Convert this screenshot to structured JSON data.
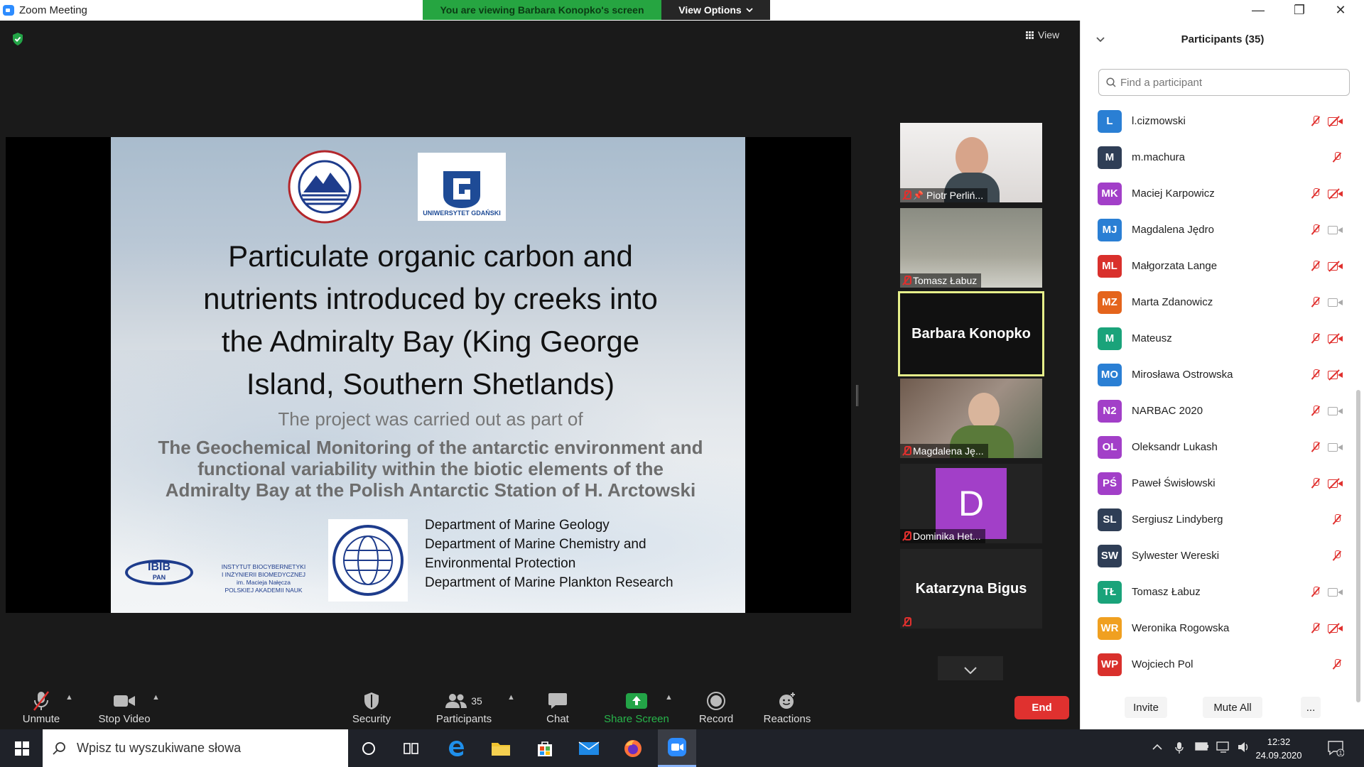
{
  "window": {
    "title": "Zoom Meeting",
    "banner": "You are viewing Barbara Konopko's screen",
    "view_options": "View Options",
    "minimize": "—",
    "restore": "❐",
    "close": "✕"
  },
  "meeting": {
    "view_label": "View",
    "slide": {
      "title_lines": [
        "Particulate organic carbon and",
        "nutrients introduced by creeks  into",
        "the Admiralty Bay (King George",
        "Island, Southern Shetlands)"
      ],
      "subtitle": "The project was carried out as part of",
      "project_lines": [
        "The Geochemical Monitoring of the antarctic environment and",
        "functional variability within the biotic elements of the",
        "Admiralty Bay at the Polish Antarctic Station of H. Arctowski"
      ],
      "departments": [
        "Department of Marine Geology",
        "Department of Marine Chemistry and",
        "Environmental Protection",
        "Department of Marine Plankton Research"
      ],
      "logo_ug_text": "UNIWERSYTET GDAŃSKI",
      "logo_ibib_text": "IBIB",
      "logo_ibib_pan": "PAN",
      "ibib_institute_lines": [
        "INSTYTUT BIOCYBERNETYKI",
        "I INŻYNIERII BIOMEDYCZNEJ",
        "im. Macieja Nałęcza",
        "POLSKIEJ AKADEMII NAUK"
      ]
    },
    "thumbnails": [
      {
        "name": "Piotr Perliń..."
      },
      {
        "name": "Tomasz Łabuz"
      },
      {
        "name": "Barbara Konopko"
      },
      {
        "name": "Magdalena Ję..."
      },
      {
        "name": "Dominika Het...",
        "initial": "D"
      },
      {
        "name": "Katarzyna Bigus"
      }
    ]
  },
  "toolbar": {
    "unmute": "Unmute",
    "stop_video": "Stop Video",
    "security": "Security",
    "participants": "Participants",
    "participants_count": "35",
    "chat": "Chat",
    "share_screen": "Share Screen",
    "record": "Record",
    "reactions": "Reactions",
    "end": "End"
  },
  "panel": {
    "title": "Participants (35)",
    "search_placeholder": "Find a participant",
    "participants": [
      {
        "initials": "L",
        "name": "l.cizmowski",
        "color": "#2a7fd4",
        "cam": "off"
      },
      {
        "initials": "M",
        "name": "m.machura",
        "color": "#2f3e56",
        "cam": "none"
      },
      {
        "initials": "MK",
        "name": "Maciej Karpowicz",
        "color": "#a23fc8",
        "cam": "off"
      },
      {
        "initials": "MJ",
        "name": "Magdalena Jędro",
        "color": "#2a7fd4",
        "cam": "on"
      },
      {
        "initials": "ML",
        "name": "Małgorzata Lange",
        "color": "#d9302c",
        "cam": "off"
      },
      {
        "initials": "MZ",
        "name": "Marta Zdanowicz",
        "color": "#e4641c",
        "cam": "on"
      },
      {
        "initials": "M",
        "name": "Mateusz",
        "color": "#1aa37a",
        "cam": "off"
      },
      {
        "initials": "MO",
        "name": "Mirosława Ostrowska",
        "color": "#2a7fd4",
        "cam": "off"
      },
      {
        "initials": "N2",
        "name": "NARBAC 2020",
        "color": "#a23fc8",
        "cam": "on"
      },
      {
        "initials": "OL",
        "name": "Oleksandr Lukash",
        "color": "#a23fc8",
        "cam": "on"
      },
      {
        "initials": "PŚ",
        "name": "Paweł Świsłowski",
        "color": "#a23fc8",
        "cam": "off"
      },
      {
        "initials": "SL",
        "name": "Sergiusz Lindyberg",
        "color": "#2f3e56",
        "cam": "none"
      },
      {
        "initials": "SW",
        "name": "Sylwester Wereski",
        "color": "#2f3e56",
        "cam": "none"
      },
      {
        "initials": "TŁ",
        "name": "Tomasz Łabuz",
        "color": "#1aa37a",
        "cam": "on"
      },
      {
        "initials": "WR",
        "name": "Weronika Rogowska",
        "color": "#f0a020",
        "cam": "off"
      },
      {
        "initials": "WP",
        "name": "Wojciech Pol",
        "color": "#d9302c",
        "cam": "none"
      }
    ],
    "invite": "Invite",
    "mute_all": "Mute All",
    "more": "..."
  },
  "taskbar": {
    "search_placeholder": "Wpisz tu wyszukiwane słowa",
    "time": "12:32",
    "date": "24.09.2020"
  },
  "colors": {
    "green_banner": "#26a541",
    "end_red": "#e0312f",
    "mute_red": "#e0302e",
    "active_speaker_border": "#e6ef8a"
  }
}
